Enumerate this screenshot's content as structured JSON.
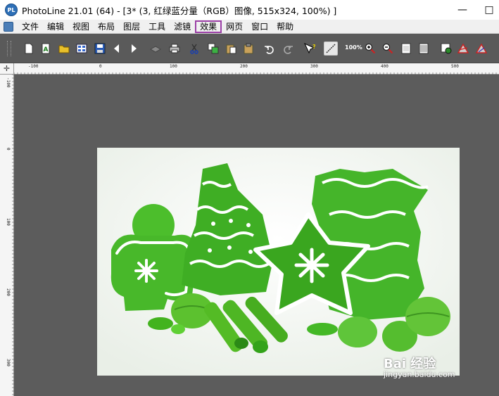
{
  "window": {
    "app_icon_text": "PL",
    "title": "PhotoLine 21.01 (64) - [3* (3, 红绿蓝分量（RGB）图像, 515x324, 100%) ]",
    "minimize": "—",
    "maximize": "□"
  },
  "menu": {
    "items": [
      "文件",
      "编辑",
      "视图",
      "布局",
      "图层",
      "工具",
      "滤镜",
      "效果",
      "网页",
      "窗口",
      "帮助"
    ],
    "highlighted_index": 7,
    "highlight_color": "#9b3fa6"
  },
  "toolbar": {
    "zoom_label": "100%",
    "icons": [
      "new-document-icon",
      "text-icon",
      "open-folder-icon",
      "image-browser-icon",
      "save-icon",
      "back-icon",
      "forward-icon",
      "scanner-icon",
      "print-icon",
      "cut-icon",
      "copy-icon",
      "paste-icon",
      "paste-special-icon",
      "undo-icon",
      "redo-icon",
      "help-cursor-icon",
      "line-tool-icon",
      "zoom-in-icon",
      "zoom-out-icon",
      "page-icon",
      "page-fit-icon",
      "rotate-icon",
      "triangle-icon-red",
      "triangle-icon-gray"
    ]
  },
  "rulers": {
    "top_labels": [
      "-100",
      "0",
      "100",
      "200",
      "300",
      "400",
      "500"
    ],
    "left_labels": [
      "-100",
      "0",
      "100",
      "200",
      "300"
    ],
    "corner_symbol": "✛"
  },
  "document": {
    "width": 515,
    "height": 324,
    "zoom": "100%",
    "background": "#f4f7f3",
    "content": "green-cookies-photo"
  },
  "watermark": {
    "brand": "Bai 经验",
    "url": "jingyan.baidu.com"
  }
}
